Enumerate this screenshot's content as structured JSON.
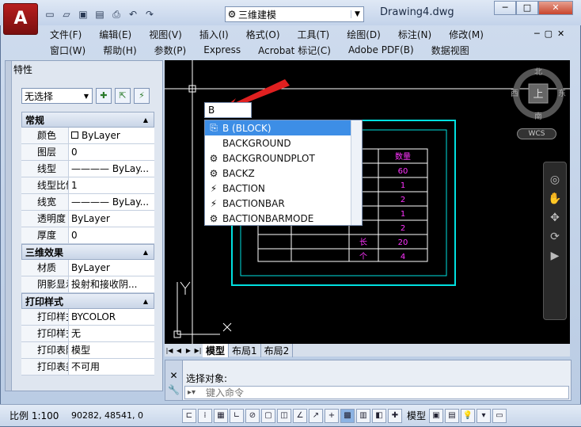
{
  "app": {
    "logo_letter": "A",
    "document_title": "Drawing4.dwg",
    "workspace": "三维建模",
    "quick_access_icons": [
      "new-icon",
      "open-icon",
      "save-icon",
      "save-as-icon",
      "plot-icon",
      "undo-icon",
      "redo-icon"
    ]
  },
  "window_controls": {
    "minimize": "─",
    "maximize": "□",
    "close": "✕"
  },
  "menu": {
    "row1": [
      "文件(F)",
      "编辑(E)",
      "视图(V)",
      "插入(I)",
      "格式(O)",
      "工具(T)",
      "绘图(D)",
      "标注(N)",
      "修改(M)"
    ],
    "row2": [
      "窗口(W)",
      "帮助(H)",
      "参数(P)",
      "Express",
      "Acrobat 标记(C)",
      "Adobe PDF(B)",
      "数据视图"
    ]
  },
  "properties": {
    "title": "特性",
    "selection": "无选择",
    "sections": [
      {
        "name": "常规",
        "rows": [
          {
            "label": "颜色",
            "value": "ByLayer",
            "swatch": true
          },
          {
            "label": "图层",
            "value": "0"
          },
          {
            "label": "线型",
            "value": "———— ByLay..."
          },
          {
            "label": "线型比例",
            "value": "1"
          },
          {
            "label": "线宽",
            "value": "———— ByLay..."
          },
          {
            "label": "透明度",
            "value": "ByLayer"
          },
          {
            "label": "厚度",
            "value": "0"
          }
        ]
      },
      {
        "name": "三维效果",
        "rows": [
          {
            "label": "材质",
            "value": "ByLayer"
          },
          {
            "label": "阴影显示",
            "value": "投射和接收阴..."
          }
        ]
      },
      {
        "name": "打印样式",
        "rows": [
          {
            "label": "打印样式",
            "value": "BYCOLOR"
          },
          {
            "label": "打印样式表",
            "value": "无"
          },
          {
            "label": "打印表附...",
            "value": "模型"
          },
          {
            "label": "打印表类型",
            "value": "不可用"
          }
        ]
      }
    ]
  },
  "viewcube": {
    "north": "北",
    "south": "南",
    "east": "东",
    "west": "西",
    "top": "上",
    "wcs": "WCS"
  },
  "canvas": {
    "typed_text": "B",
    "autocomplete": [
      {
        "label": "B (BLOCK)",
        "icon": "block-icon",
        "selected": true
      },
      {
        "label": "BACKGROUND",
        "icon": "none"
      },
      {
        "label": "BACKGROUNDPLOT",
        "icon": "gear-icon"
      },
      {
        "label": "BACKZ",
        "icon": "gear-icon"
      },
      {
        "label": "BACTION",
        "icon": "lightning-icon"
      },
      {
        "label": "BACTIONBAR",
        "icon": "lightning-gear-icon"
      },
      {
        "label": "BACTIONBARMODE",
        "icon": "gear-icon"
      }
    ],
    "table": {
      "header": "数量",
      "right_col": [
        "60",
        "1",
        "2",
        "1",
        "2",
        "20",
        "4"
      ],
      "mid_col": [
        "",
        "",
        "",
        "",
        "",
        "长",
        "个"
      ]
    },
    "ucs": {
      "x": "X",
      "y": "Y"
    }
  },
  "tabs": [
    "模型",
    "布局1",
    "布局2"
  ],
  "command": {
    "history": "选择对象:",
    "placeholder": "键入命令"
  },
  "status": {
    "scale": "比例 1:100",
    "coords": "90282,  48541, 0",
    "model": "模型"
  },
  "colors": {
    "canvas": "#000000",
    "cyan": "#00e0e0",
    "magenta": "#ff33ff",
    "selection": "#3d8ee6"
  }
}
